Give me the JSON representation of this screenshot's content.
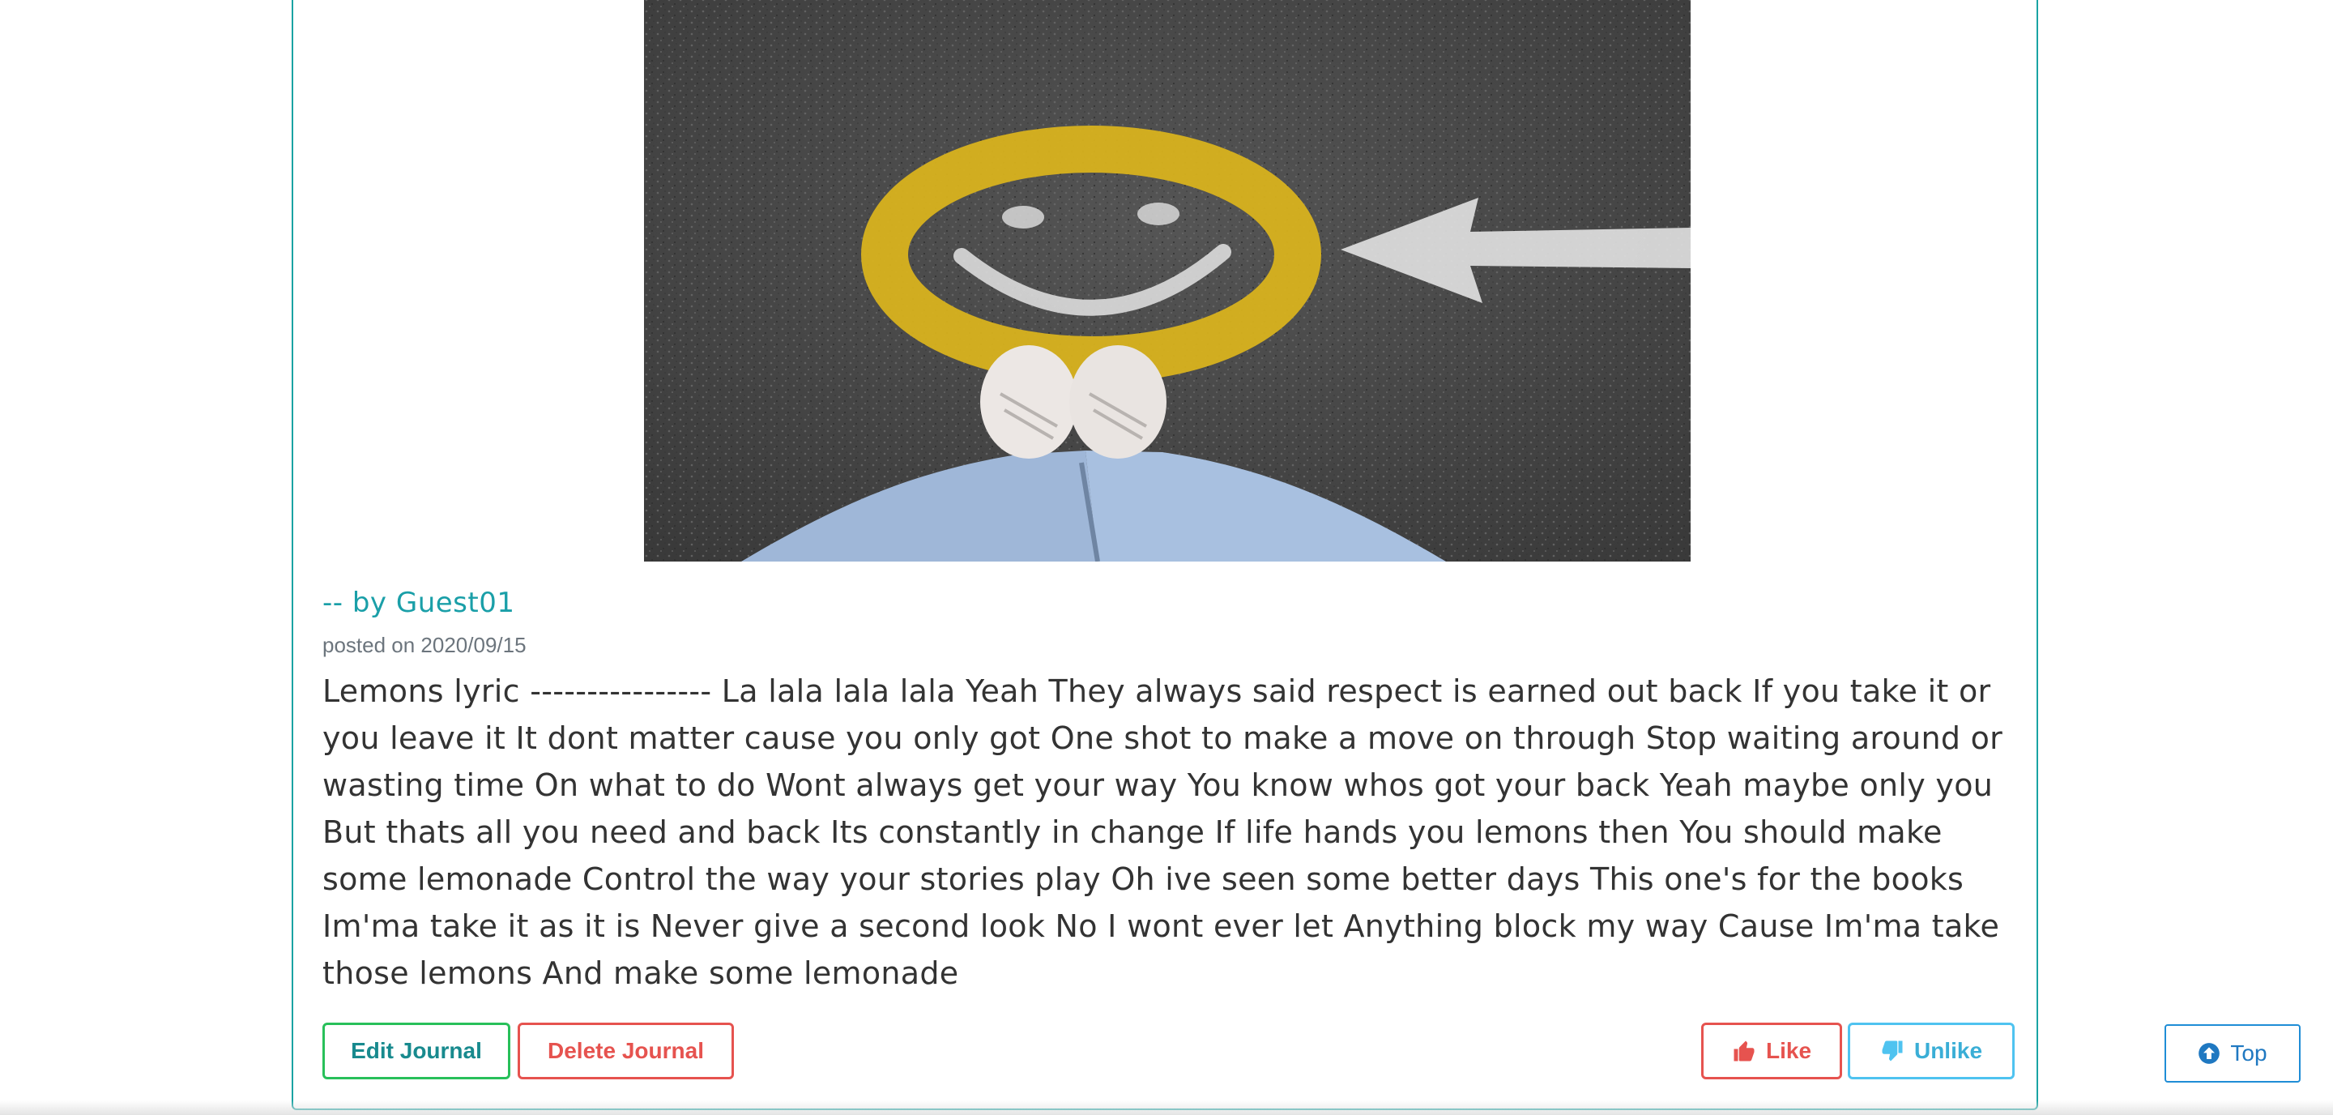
{
  "post": {
    "author": "-- by Guest01",
    "posted": "posted on 2020/09/15",
    "body": "Lemons lyric ---------------- La lala lala lala Yeah They always said respect is earned out back If you take it or you leave it It dont matter cause you only got One shot to make a move on through Stop waiting around or wasting time On what to do Wont always get your way You know whos got your back Yeah maybe only you But thats all you need and back Its constantly in change If life hands you lemons then You should make some lemonade Control the way your stories play Oh ive seen some better days This one's for the books Im'ma take it as it is Never give a second look No I wont ever let Anything block my way Cause Im'ma take those lemons And make some lemonade",
    "image_icon": "smiley-photo"
  },
  "actions": {
    "edit_label": "Edit Journal",
    "delete_label": "Delete Journal",
    "like_label": "Like",
    "unlike_label": "Unlike",
    "like_icon": "thumbs-up-icon",
    "unlike_icon": "thumbs-down-icon"
  },
  "nav": {
    "top_label": "Top",
    "top_icon": "arrow-circle-up-icon"
  },
  "colors": {
    "card_border": "#1aa3a3",
    "author": "#1a9fa8",
    "edit_border": "#28c05a",
    "danger": "#e6534f",
    "info": "#4fc3f0",
    "primary": "#1f78c1"
  }
}
